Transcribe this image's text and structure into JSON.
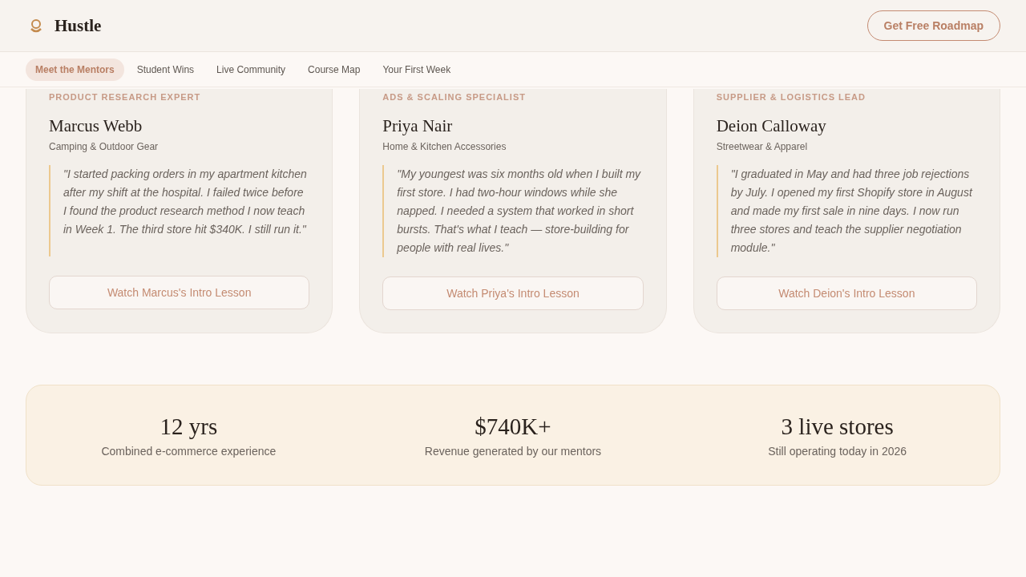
{
  "brand": {
    "name": "Hustle"
  },
  "header_button": "Get Free Roadmap",
  "nav": [
    {
      "label": "Meet the Mentors",
      "selected": true
    },
    {
      "label": "Student Wins",
      "selected": false
    },
    {
      "label": "Live Community",
      "selected": false
    },
    {
      "label": "Course Map",
      "selected": false
    },
    {
      "label": "Your First Week",
      "selected": false
    }
  ],
  "mentors": [
    {
      "role": "PRODUCT RESEARCH EXPERT",
      "name": "Marcus Webb",
      "niche": "Camping & Outdoor Gear",
      "quote": "\"I started packing orders in my apartment kitchen after my shift at the hospital. I failed twice before I found the product research method I now teach in Week 1. The third store hit $340K. I still run it.\"",
      "button": "Watch Marcus's Intro Lesson"
    },
    {
      "role": "ADS & SCALING SPECIALIST",
      "name": "Priya Nair",
      "niche": "Home & Kitchen Accessories",
      "quote": "\"My youngest was six months old when I built my first store. I had two-hour windows while she napped. I needed a system that worked in short bursts. That's what I teach — store-building for people with real lives.\"",
      "button": "Watch Priya's Intro Lesson"
    },
    {
      "role": "SUPPLIER & LOGISTICS LEAD",
      "name": "Deion Calloway",
      "niche": "Streetwear & Apparel",
      "quote": "\"I graduated in May and had three job rejections by July. I opened my first Shopify store in August and made my first sale in nine days. I now run three stores and teach the supplier negotiation module.\"",
      "button": "Watch Deion's Intro Lesson"
    }
  ],
  "stats": [
    {
      "value": "12 yrs",
      "label": "Combined e-commerce experience"
    },
    {
      "value": "$740K+",
      "label": "Revenue generated by our mentors"
    },
    {
      "value": "3 live stores",
      "label": "Still operating today in 2026"
    }
  ]
}
